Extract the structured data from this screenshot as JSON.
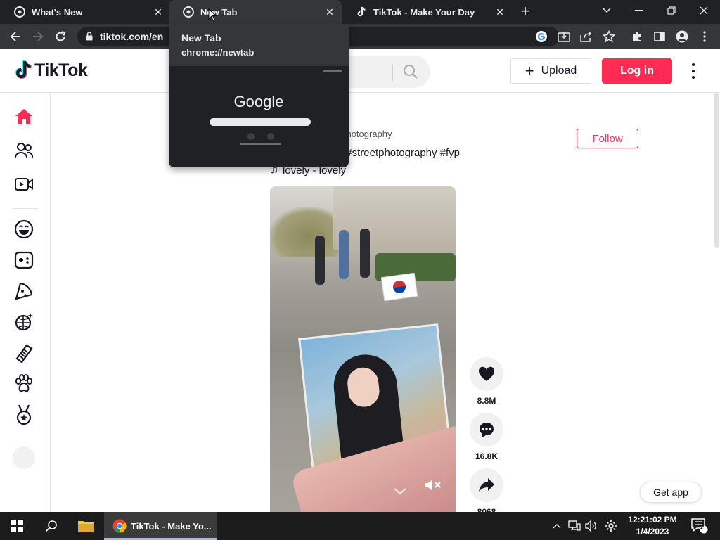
{
  "browser": {
    "tabs": [
      {
        "title": "What's New",
        "active": false
      },
      {
        "title": "New Tab",
        "active": true
      },
      {
        "title": "TikTok - Make Your Day",
        "active": false
      }
    ],
    "url_main": "tiktok.com/en",
    "hover_card": {
      "title": "New Tab",
      "url": "chrome://newtab",
      "preview_logo": "Google"
    }
  },
  "tiktok": {
    "logo_text": "TikTok",
    "upload_label": "Upload",
    "login_label": "Log in",
    "sidebar_icons": [
      "home-icon",
      "following-icon",
      "live-icon",
      "comedy-icon",
      "gaming-icon",
      "food-icon",
      "dance-icon",
      "beauty-icon",
      "animals-icon",
      "sports-icon"
    ],
    "post": {
      "author_partial": "_photography",
      "follow_label": "Follow",
      "caption": "#streetphotography #fyp",
      "music": "lovely - lovely",
      "likes": "8.8M",
      "comments": "16.8K",
      "shares": "8068"
    },
    "get_app_label": "Get app"
  },
  "taskbar": {
    "chrome_window_title": "TikTok - Make Yo...",
    "time": "12:21:02 PM",
    "date": "1/4/2023",
    "notification_count": "2"
  },
  "colors": {
    "brand": "#fe2c55",
    "chrome_dark": "#202124",
    "chrome_active": "#35363a"
  }
}
